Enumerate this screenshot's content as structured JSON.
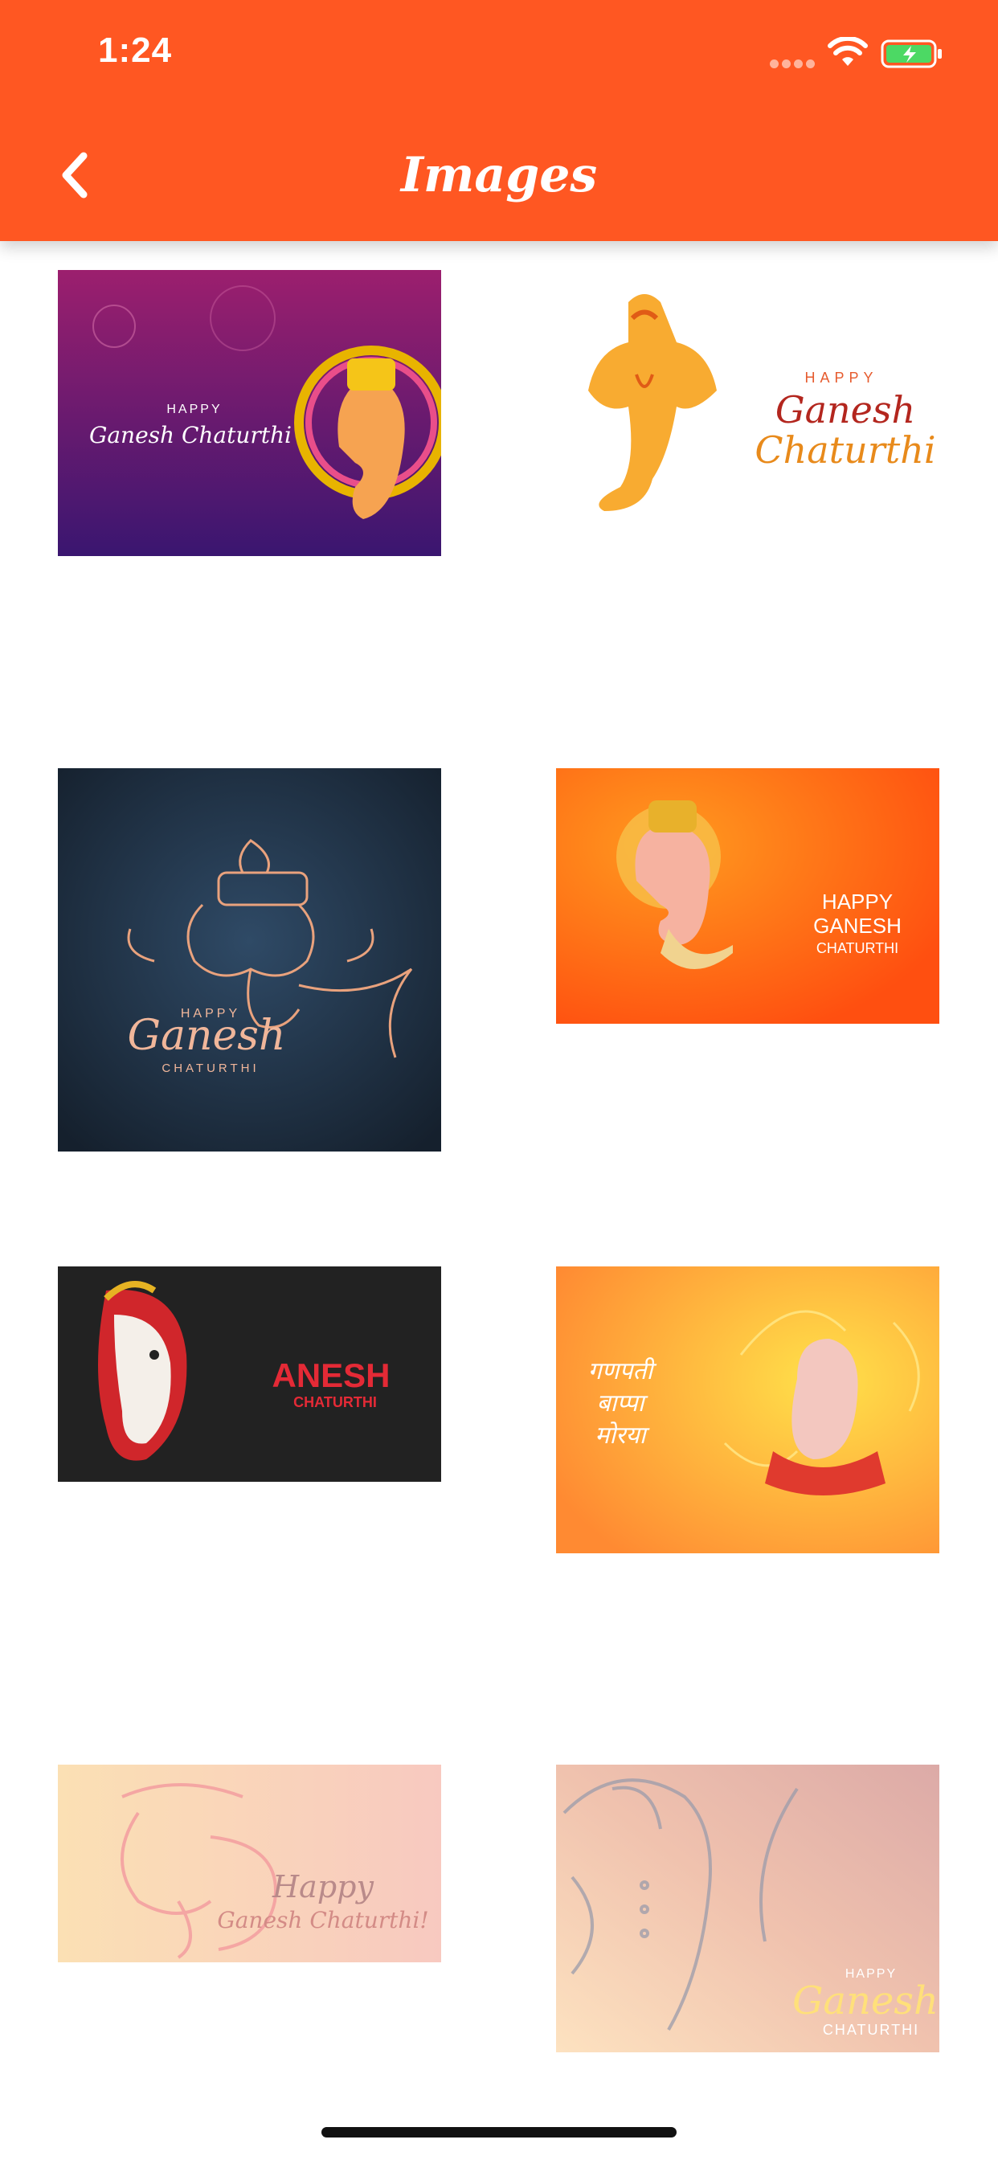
{
  "status_bar": {
    "time": "1:24"
  },
  "header": {
    "title": "Images",
    "back_icon": "chevron-left-icon"
  },
  "colors": {
    "accent": "#FF5722",
    "background": "#FFFFFF"
  },
  "images": [
    {
      "lines": [
        "HAPPY",
        "Ganesh Chaturthi"
      ]
    },
    {
      "lines": [
        "HAPPY",
        "Ganesh",
        "Chaturthi"
      ]
    },
    {
      "lines": [
        "HAPPY",
        "Ganesh",
        "CHATURTHI"
      ]
    },
    {
      "lines": [
        "HAPPY",
        "GANESH",
        "CHATURTHI"
      ]
    },
    {
      "lines": [
        "ANESH",
        "CHATURTHI"
      ]
    },
    {
      "lines": [
        "गणपती",
        "बाप्पा",
        "मोरया"
      ]
    },
    {
      "lines": [
        "Happy",
        "Ganesh Chaturthi!"
      ]
    },
    {
      "lines": [
        "HAPPY",
        "Ganesh",
        "CHATURTHI"
      ]
    }
  ]
}
